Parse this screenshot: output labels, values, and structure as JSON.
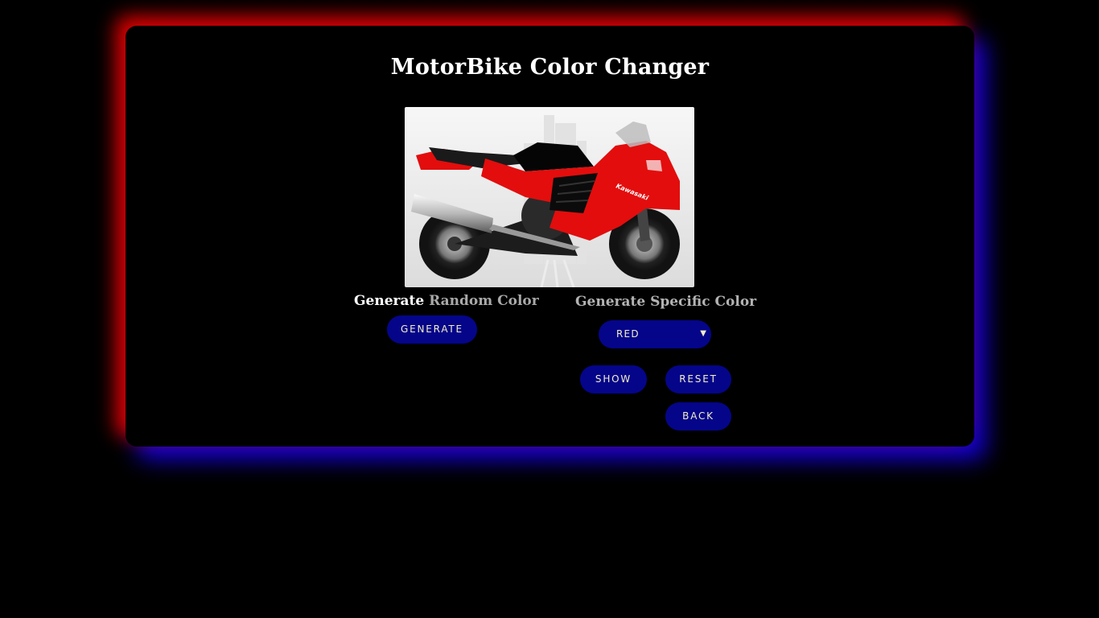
{
  "title": "MotorBike Color Changer",
  "bike_image": {
    "body_color": "#e30d0d",
    "brand_text": "Kawasaki"
  },
  "random_section": {
    "label_first": "Generate",
    "label_rest": " Random Color",
    "generate_button": "GENERATE"
  },
  "specific_section": {
    "label": "Generate Specific Color",
    "color_select": {
      "selected": "RED"
    },
    "show_button": "SHOW",
    "reset_button": "RESET",
    "back_button": "BACK"
  },
  "colors": {
    "button_bg": "#05058a",
    "button_text": "#f2eec8",
    "glow_red": "#e00000",
    "glow_blue": "#1400d8"
  }
}
